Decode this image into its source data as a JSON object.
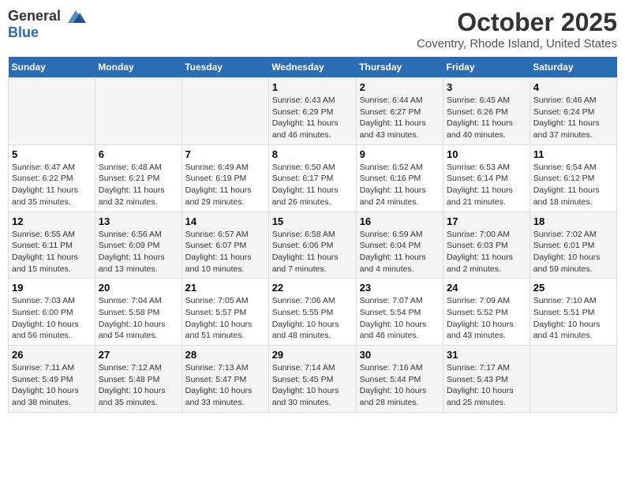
{
  "header": {
    "logo_general": "General",
    "logo_blue": "Blue",
    "month_title": "October 2025",
    "location": "Coventry, Rhode Island, United States"
  },
  "calendar": {
    "days_of_week": [
      "Sunday",
      "Monday",
      "Tuesday",
      "Wednesday",
      "Thursday",
      "Friday",
      "Saturday"
    ],
    "weeks": [
      [
        {
          "day": "",
          "content": ""
        },
        {
          "day": "",
          "content": ""
        },
        {
          "day": "",
          "content": ""
        },
        {
          "day": "1",
          "content": "Sunrise: 6:43 AM\nSunset: 6:29 PM\nDaylight: 11 hours\nand 46 minutes."
        },
        {
          "day": "2",
          "content": "Sunrise: 6:44 AM\nSunset: 6:27 PM\nDaylight: 11 hours\nand 43 minutes."
        },
        {
          "day": "3",
          "content": "Sunrise: 6:45 AM\nSunset: 6:26 PM\nDaylight: 11 hours\nand 40 minutes."
        },
        {
          "day": "4",
          "content": "Sunrise: 6:46 AM\nSunset: 6:24 PM\nDaylight: 11 hours\nand 37 minutes."
        }
      ],
      [
        {
          "day": "5",
          "content": "Sunrise: 6:47 AM\nSunset: 6:22 PM\nDaylight: 11 hours\nand 35 minutes."
        },
        {
          "day": "6",
          "content": "Sunrise: 6:48 AM\nSunset: 6:21 PM\nDaylight: 11 hours\nand 32 minutes."
        },
        {
          "day": "7",
          "content": "Sunrise: 6:49 AM\nSunset: 6:19 PM\nDaylight: 11 hours\nand 29 minutes."
        },
        {
          "day": "8",
          "content": "Sunrise: 6:50 AM\nSunset: 6:17 PM\nDaylight: 11 hours\nand 26 minutes."
        },
        {
          "day": "9",
          "content": "Sunrise: 6:52 AM\nSunset: 6:16 PM\nDaylight: 11 hours\nand 24 minutes."
        },
        {
          "day": "10",
          "content": "Sunrise: 6:53 AM\nSunset: 6:14 PM\nDaylight: 11 hours\nand 21 minutes."
        },
        {
          "day": "11",
          "content": "Sunrise: 6:54 AM\nSunset: 6:12 PM\nDaylight: 11 hours\nand 18 minutes."
        }
      ],
      [
        {
          "day": "12",
          "content": "Sunrise: 6:55 AM\nSunset: 6:11 PM\nDaylight: 11 hours\nand 15 minutes."
        },
        {
          "day": "13",
          "content": "Sunrise: 6:56 AM\nSunset: 6:09 PM\nDaylight: 11 hours\nand 13 minutes."
        },
        {
          "day": "14",
          "content": "Sunrise: 6:57 AM\nSunset: 6:07 PM\nDaylight: 11 hours\nand 10 minutes."
        },
        {
          "day": "15",
          "content": "Sunrise: 6:58 AM\nSunset: 6:06 PM\nDaylight: 11 hours\nand 7 minutes."
        },
        {
          "day": "16",
          "content": "Sunrise: 6:59 AM\nSunset: 6:04 PM\nDaylight: 11 hours\nand 4 minutes."
        },
        {
          "day": "17",
          "content": "Sunrise: 7:00 AM\nSunset: 6:03 PM\nDaylight: 11 hours\nand 2 minutes."
        },
        {
          "day": "18",
          "content": "Sunrise: 7:02 AM\nSunset: 6:01 PM\nDaylight: 10 hours\nand 59 minutes."
        }
      ],
      [
        {
          "day": "19",
          "content": "Sunrise: 7:03 AM\nSunset: 6:00 PM\nDaylight: 10 hours\nand 56 minutes."
        },
        {
          "day": "20",
          "content": "Sunrise: 7:04 AM\nSunset: 5:58 PM\nDaylight: 10 hours\nand 54 minutes."
        },
        {
          "day": "21",
          "content": "Sunrise: 7:05 AM\nSunset: 5:57 PM\nDaylight: 10 hours\nand 51 minutes."
        },
        {
          "day": "22",
          "content": "Sunrise: 7:06 AM\nSunset: 5:55 PM\nDaylight: 10 hours\nand 48 minutes."
        },
        {
          "day": "23",
          "content": "Sunrise: 7:07 AM\nSunset: 5:54 PM\nDaylight: 10 hours\nand 46 minutes."
        },
        {
          "day": "24",
          "content": "Sunrise: 7:09 AM\nSunset: 5:52 PM\nDaylight: 10 hours\nand 43 minutes."
        },
        {
          "day": "25",
          "content": "Sunrise: 7:10 AM\nSunset: 5:51 PM\nDaylight: 10 hours\nand 41 minutes."
        }
      ],
      [
        {
          "day": "26",
          "content": "Sunrise: 7:11 AM\nSunset: 5:49 PM\nDaylight: 10 hours\nand 38 minutes."
        },
        {
          "day": "27",
          "content": "Sunrise: 7:12 AM\nSunset: 5:48 PM\nDaylight: 10 hours\nand 35 minutes."
        },
        {
          "day": "28",
          "content": "Sunrise: 7:13 AM\nSunset: 5:47 PM\nDaylight: 10 hours\nand 33 minutes."
        },
        {
          "day": "29",
          "content": "Sunrise: 7:14 AM\nSunset: 5:45 PM\nDaylight: 10 hours\nand 30 minutes."
        },
        {
          "day": "30",
          "content": "Sunrise: 7:16 AM\nSunset: 5:44 PM\nDaylight: 10 hours\nand 28 minutes."
        },
        {
          "day": "31",
          "content": "Sunrise: 7:17 AM\nSunset: 5:43 PM\nDaylight: 10 hours\nand 25 minutes."
        },
        {
          "day": "",
          "content": ""
        }
      ]
    ]
  }
}
